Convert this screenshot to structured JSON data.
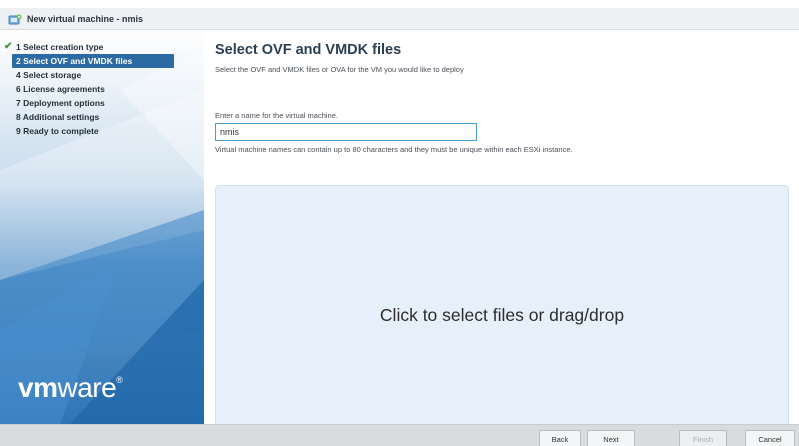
{
  "window": {
    "title": "New virtual machine - nmis"
  },
  "sidebar": {
    "steps": [
      {
        "label": "1 Select creation type",
        "completed": true
      },
      {
        "label": "2 Select OVF and VMDK files",
        "active": true
      },
      {
        "label": "4 Select storage"
      },
      {
        "label": "6 License agreements"
      },
      {
        "label": "7 Deployment options"
      },
      {
        "label": "8 Additional settings"
      },
      {
        "label": "9 Ready to complete"
      }
    ],
    "brand": {
      "vm": "vm",
      "ware": "ware",
      "mark": "®"
    }
  },
  "main": {
    "title": "Select OVF and VMDK files",
    "subtitle": "Select the OVF and VMDK files or OVA for the VM you would like to deploy",
    "name_label": "Enter a name for the virtual machine.",
    "name_value": "nmis",
    "name_hint": "Virtual machine names can contain up to 80 characters and they must be unique within each ESXi instance.",
    "dropzone_text": "Click to select files or drag/drop"
  },
  "footer": {
    "back": "Back",
    "next": "Next",
    "finish": "Finish",
    "cancel": "Cancel"
  },
  "colors": {
    "accent": "#2b6aa3",
    "check": "#3c9c2f",
    "dropzone": "#e6f0fa",
    "input_border": "#4da0d6"
  },
  "icons": {
    "title": "new-vm-icon",
    "completed_step": "check-icon"
  }
}
